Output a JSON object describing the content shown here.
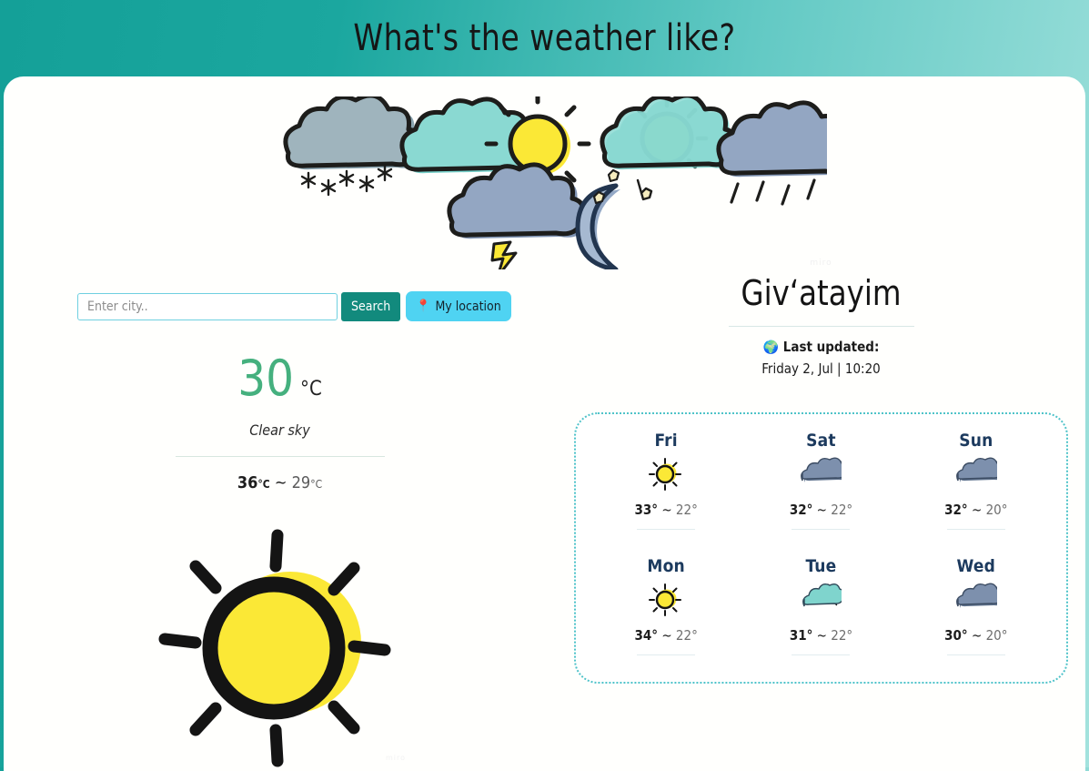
{
  "header": {
    "title": "What's the weather like?",
    "illustration_icons": [
      "snow-cloud-icon",
      "cloud-icon",
      "sun-icon",
      "partly-cloudy-icon",
      "rain-cloud-icon",
      "thunderstorm-cloud-icon",
      "moon-stars-icon"
    ]
  },
  "search": {
    "placeholder": "Enter city..",
    "value": "",
    "search_label": "Search",
    "location_label": "My location",
    "location_icon": "map-pin-icon",
    "search_button_color": "#128a7d",
    "location_button_color": "#4fd3f2"
  },
  "current": {
    "temperature": "30",
    "unit": "°C",
    "temperature_color": "#45b07e",
    "description": "Clear sky",
    "high": "36",
    "high_unit": "°C",
    "separator": "~",
    "low": "29",
    "low_unit": "°C",
    "icon": "sun-icon"
  },
  "location": {
    "watermark": "miro",
    "city": "Giv‘atayim",
    "updated_icon": "globe-icon",
    "updated_label": "Last updated:",
    "updated_time": "Friday 2, Jul | 10:20"
  },
  "forecast": {
    "border_color": "#4fc3c9",
    "days": [
      {
        "name": "Fri",
        "icon": "sun-icon",
        "high": "33°",
        "sep": "~",
        "low": "22°"
      },
      {
        "name": "Sat",
        "icon": "cloudy-icon",
        "high": "32°",
        "sep": "~",
        "low": "22°"
      },
      {
        "name": "Sun",
        "icon": "cloudy-icon",
        "high": "32°",
        "sep": "~",
        "low": "20°"
      },
      {
        "name": "Mon",
        "icon": "sun-icon",
        "high": "34°",
        "sep": "~",
        "low": "22°"
      },
      {
        "name": "Tue",
        "icon": "partly-cloudy-icon",
        "high": "31°",
        "sep": "~",
        "low": "22°"
      },
      {
        "name": "Wed",
        "icon": "cloudy-icon",
        "high": "30°",
        "sep": "~",
        "low": "20°"
      }
    ]
  },
  "footer": {
    "watermark": "miro"
  }
}
